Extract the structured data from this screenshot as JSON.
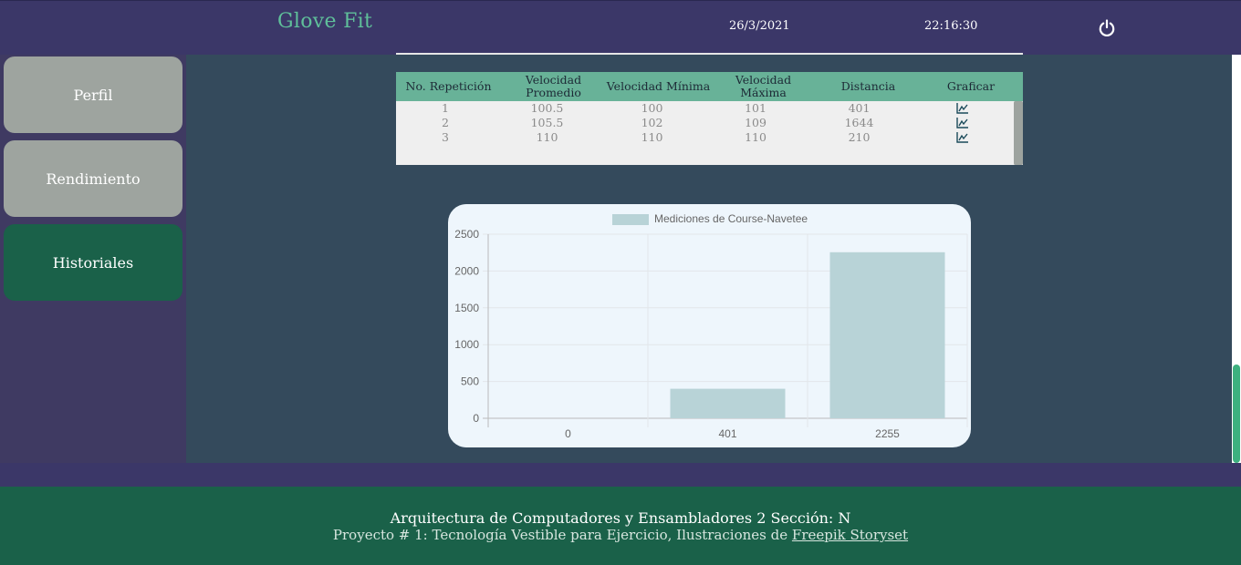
{
  "header": {
    "brand": "Glove Fit",
    "date": "26/3/2021",
    "time": "22:16:30",
    "power_icon": "power-icon"
  },
  "sidebar": {
    "items": [
      {
        "label": "Perfil",
        "state": "inactive"
      },
      {
        "label": "Rendimiento",
        "state": "inactive"
      },
      {
        "label": "Historiales",
        "state": "active"
      }
    ]
  },
  "table": {
    "headers": [
      "No. Repetición",
      "Velocidad Promedio",
      "Velocidad Mínima",
      "Velocidad Máxima",
      "Distancia",
      "Graficar"
    ],
    "rows": [
      [
        "1",
        "100.5",
        "100",
        "101",
        "401"
      ],
      [
        "2",
        "105.5",
        "102",
        "109",
        "1644"
      ],
      [
        "3",
        "110",
        "110",
        "110",
        "210"
      ]
    ],
    "row_action_icon": "line-chart-icon"
  },
  "chart_data": {
    "type": "bar",
    "legend": "Mediciones de Course-Navetee",
    "legend_position": "top",
    "categories": [
      "0",
      "401",
      "2255"
    ],
    "series": [
      {
        "name": "Mediciones de Course-Navetee",
        "values": [
          0,
          401,
          2255
        ]
      }
    ],
    "yticks": [
      "2500",
      "2000",
      "1500",
      "1000",
      "500",
      "0"
    ],
    "ylim": [
      0,
      2500
    ],
    "grid": true,
    "bar_color": "#b8d3d7"
  },
  "footer": {
    "title": "Arquitectura de Computadores y Ensambladores 2 Sección: N",
    "subtitle": "Proyecto # 1: Tecnología Vestible para Ejercicio, Ilustraciones de",
    "link": "Freepik Storyset"
  },
  "colors": {
    "header_bg": "#3b3768",
    "main_bg": "#344a5c",
    "accent_green": "#1a6149",
    "table_header": "#68b298",
    "brand": "#5fbf9a"
  }
}
